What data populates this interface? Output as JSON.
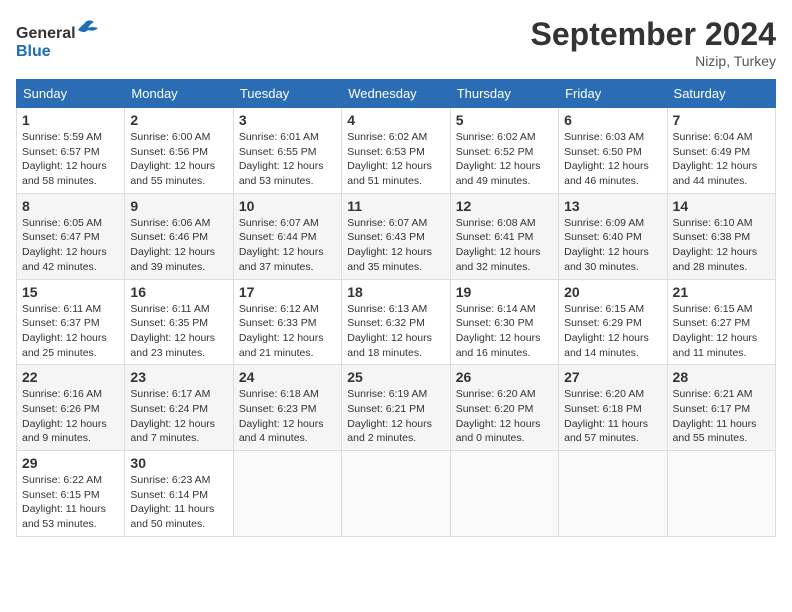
{
  "header": {
    "title": "September 2024",
    "location": "Nizip, Turkey",
    "logo_general": "General",
    "logo_blue": "Blue"
  },
  "weekdays": [
    "Sunday",
    "Monday",
    "Tuesday",
    "Wednesday",
    "Thursday",
    "Friday",
    "Saturday"
  ],
  "weeks": [
    [
      {
        "day": "1",
        "sunrise": "5:59 AM",
        "sunset": "6:57 PM",
        "daylight": "12 hours and 58 minutes."
      },
      {
        "day": "2",
        "sunrise": "6:00 AM",
        "sunset": "6:56 PM",
        "daylight": "12 hours and 55 minutes."
      },
      {
        "day": "3",
        "sunrise": "6:01 AM",
        "sunset": "6:55 PM",
        "daylight": "12 hours and 53 minutes."
      },
      {
        "day": "4",
        "sunrise": "6:02 AM",
        "sunset": "6:53 PM",
        "daylight": "12 hours and 51 minutes."
      },
      {
        "day": "5",
        "sunrise": "6:02 AM",
        "sunset": "6:52 PM",
        "daylight": "12 hours and 49 minutes."
      },
      {
        "day": "6",
        "sunrise": "6:03 AM",
        "sunset": "6:50 PM",
        "daylight": "12 hours and 46 minutes."
      },
      {
        "day": "7",
        "sunrise": "6:04 AM",
        "sunset": "6:49 PM",
        "daylight": "12 hours and 44 minutes."
      }
    ],
    [
      {
        "day": "8",
        "sunrise": "6:05 AM",
        "sunset": "6:47 PM",
        "daylight": "12 hours and 42 minutes."
      },
      {
        "day": "9",
        "sunrise": "6:06 AM",
        "sunset": "6:46 PM",
        "daylight": "12 hours and 39 minutes."
      },
      {
        "day": "10",
        "sunrise": "6:07 AM",
        "sunset": "6:44 PM",
        "daylight": "12 hours and 37 minutes."
      },
      {
        "day": "11",
        "sunrise": "6:07 AM",
        "sunset": "6:43 PM",
        "daylight": "12 hours and 35 minutes."
      },
      {
        "day": "12",
        "sunrise": "6:08 AM",
        "sunset": "6:41 PM",
        "daylight": "12 hours and 32 minutes."
      },
      {
        "day": "13",
        "sunrise": "6:09 AM",
        "sunset": "6:40 PM",
        "daylight": "12 hours and 30 minutes."
      },
      {
        "day": "14",
        "sunrise": "6:10 AM",
        "sunset": "6:38 PM",
        "daylight": "12 hours and 28 minutes."
      }
    ],
    [
      {
        "day": "15",
        "sunrise": "6:11 AM",
        "sunset": "6:37 PM",
        "daylight": "12 hours and 25 minutes."
      },
      {
        "day": "16",
        "sunrise": "6:11 AM",
        "sunset": "6:35 PM",
        "daylight": "12 hours and 23 minutes."
      },
      {
        "day": "17",
        "sunrise": "6:12 AM",
        "sunset": "6:33 PM",
        "daylight": "12 hours and 21 minutes."
      },
      {
        "day": "18",
        "sunrise": "6:13 AM",
        "sunset": "6:32 PM",
        "daylight": "12 hours and 18 minutes."
      },
      {
        "day": "19",
        "sunrise": "6:14 AM",
        "sunset": "6:30 PM",
        "daylight": "12 hours and 16 minutes."
      },
      {
        "day": "20",
        "sunrise": "6:15 AM",
        "sunset": "6:29 PM",
        "daylight": "12 hours and 14 minutes."
      },
      {
        "day": "21",
        "sunrise": "6:15 AM",
        "sunset": "6:27 PM",
        "daylight": "12 hours and 11 minutes."
      }
    ],
    [
      {
        "day": "22",
        "sunrise": "6:16 AM",
        "sunset": "6:26 PM",
        "daylight": "12 hours and 9 minutes."
      },
      {
        "day": "23",
        "sunrise": "6:17 AM",
        "sunset": "6:24 PM",
        "daylight": "12 hours and 7 minutes."
      },
      {
        "day": "24",
        "sunrise": "6:18 AM",
        "sunset": "6:23 PM",
        "daylight": "12 hours and 4 minutes."
      },
      {
        "day": "25",
        "sunrise": "6:19 AM",
        "sunset": "6:21 PM",
        "daylight": "12 hours and 2 minutes."
      },
      {
        "day": "26",
        "sunrise": "6:20 AM",
        "sunset": "6:20 PM",
        "daylight": "12 hours and 0 minutes."
      },
      {
        "day": "27",
        "sunrise": "6:20 AM",
        "sunset": "6:18 PM",
        "daylight": "11 hours and 57 minutes."
      },
      {
        "day": "28",
        "sunrise": "6:21 AM",
        "sunset": "6:17 PM",
        "daylight": "11 hours and 55 minutes."
      }
    ],
    [
      {
        "day": "29",
        "sunrise": "6:22 AM",
        "sunset": "6:15 PM",
        "daylight": "11 hours and 53 minutes."
      },
      {
        "day": "30",
        "sunrise": "6:23 AM",
        "sunset": "6:14 PM",
        "daylight": "11 hours and 50 minutes."
      },
      null,
      null,
      null,
      null,
      null
    ]
  ],
  "labels": {
    "sunrise": "Sunrise: ",
    "sunset": "Sunset: ",
    "daylight": "Daylight: "
  }
}
